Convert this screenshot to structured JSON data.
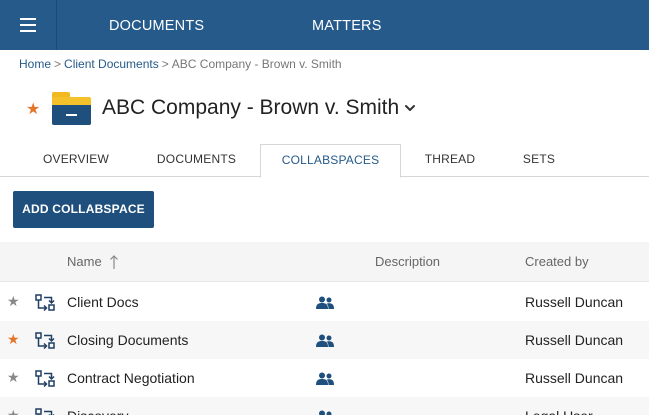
{
  "nav": {
    "documents": "DOCUMENTS",
    "matters": "MATTERS"
  },
  "breadcrumb": {
    "home": "Home",
    "separator": ">",
    "client_documents": "Client Documents",
    "current": "ABC Company - Brown v. Smith"
  },
  "header": {
    "title": "ABC Company - Brown v. Smith",
    "favorite": true
  },
  "tabs": [
    {
      "label": "OVERVIEW",
      "active": false
    },
    {
      "label": "DOCUMENTS",
      "active": false
    },
    {
      "label": "COLLABSPACES",
      "active": true
    },
    {
      "label": "THREAD",
      "active": false
    },
    {
      "label": "SETS",
      "active": false
    }
  ],
  "actions": {
    "add_label": "ADD COLLABSPACE"
  },
  "table": {
    "columns": {
      "name": "Name",
      "description": "Description",
      "created_by": "Created by"
    },
    "sort": {
      "column": "name",
      "direction": "ascending"
    },
    "rows": [
      {
        "name": "Client Docs",
        "description": "",
        "created_by": "Russell Duncan",
        "favorite": false,
        "shared": true
      },
      {
        "name": "Closing Documents",
        "description": "",
        "created_by": "Russell Duncan",
        "favorite": true,
        "shared": true
      },
      {
        "name": "Contract Negotiation",
        "description": "",
        "created_by": "Russell Duncan",
        "favorite": false,
        "shared": true
      },
      {
        "name": "Discovery",
        "description": "",
        "created_by": "Legal User",
        "favorite": false,
        "shared": true
      }
    ]
  },
  "colors": {
    "brand": "#255a8a",
    "button": "#1f4f7c",
    "favorite": "#e2752a",
    "folder": "#f5c12b"
  },
  "icons": {
    "menu": "hamburger-icon",
    "favorite": "star-icon",
    "folder": "folder-icon",
    "dropdown": "chevron-down-icon",
    "sort": "sort-ascending-icon",
    "collabspace": "collabspace-icon",
    "shared": "people-icon"
  }
}
